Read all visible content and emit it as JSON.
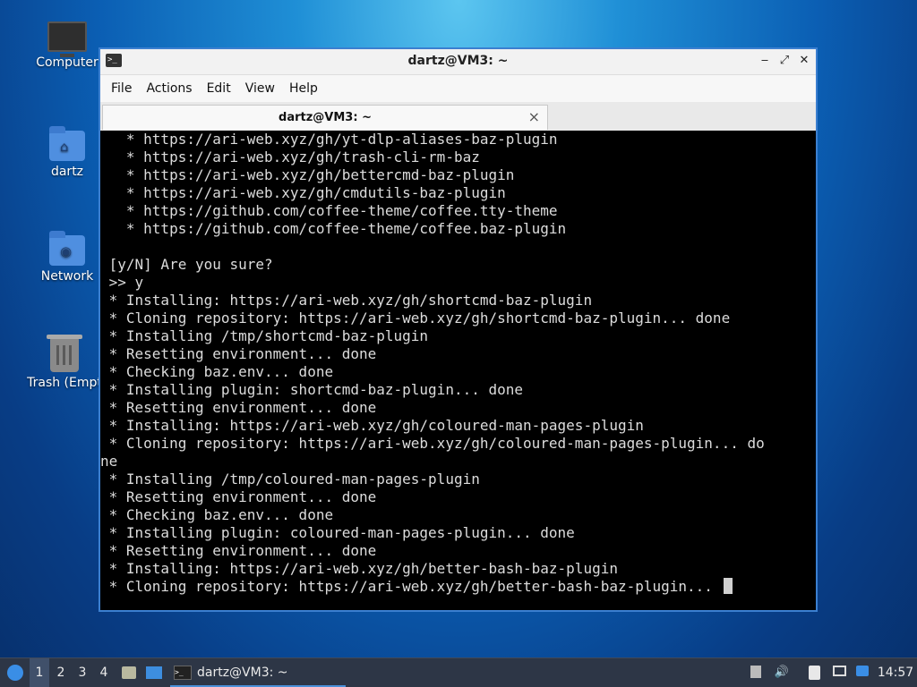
{
  "desktop": {
    "icons": [
      {
        "label": "Computer",
        "icon": "computer-icon"
      },
      {
        "label": "dartz",
        "icon": "home-folder-icon"
      },
      {
        "label": "Network",
        "icon": "network-folder-icon"
      },
      {
        "label": "Trash (Empt",
        "icon": "trash-icon"
      }
    ]
  },
  "window": {
    "title": "dartz@VM3: ~",
    "menu": [
      "File",
      "Actions",
      "Edit",
      "View",
      "Help"
    ],
    "tab_label": "dartz@VM3: ~",
    "tab_close": "×",
    "buttons": {
      "minimize": "‒",
      "maximize": "⤢",
      "close": "✕"
    }
  },
  "terminal": {
    "lines": [
      "   * https://ari-web.xyz/gh/yt-dlp-aliases-baz-plugin",
      "   * https://ari-web.xyz/gh/trash-cli-rm-baz",
      "   * https://ari-web.xyz/gh/bettercmd-baz-plugin",
      "   * https://ari-web.xyz/gh/cmdutils-baz-plugin",
      "   * https://github.com/coffee-theme/coffee.tty-theme",
      "   * https://github.com/coffee-theme/coffee.baz-plugin",
      "",
      " [y/N] Are you sure?",
      " >> y",
      " * Installing: https://ari-web.xyz/gh/shortcmd-baz-plugin",
      " * Cloning repository: https://ari-web.xyz/gh/shortcmd-baz-plugin... done",
      " * Installing /tmp/shortcmd-baz-plugin",
      " * Resetting environment... done",
      " * Checking baz.env... done",
      " * Installing plugin: shortcmd-baz-plugin... done",
      " * Resetting environment... done",
      " * Installing: https://ari-web.xyz/gh/coloured-man-pages-plugin",
      " * Cloning repository: https://ari-web.xyz/gh/coloured-man-pages-plugin... do",
      "ne",
      " * Installing /tmp/coloured-man-pages-plugin",
      " * Resetting environment... done",
      " * Checking baz.env... done",
      " * Installing plugin: coloured-man-pages-plugin... done",
      " * Resetting environment... done",
      " * Installing: https://ari-web.xyz/gh/better-bash-baz-plugin",
      " * Cloning repository: https://ari-web.xyz/gh/better-bash-baz-plugin... "
    ]
  },
  "taskbar": {
    "workspaces": [
      "1",
      "2",
      "3",
      "4"
    ],
    "active_workspace": "1",
    "task_label": "dartz@VM3: ~",
    "clock": "14:57"
  },
  "colors": {
    "accent": "#3b7fd0",
    "terminal_bg": "#000000",
    "terminal_fg": "#dcdcdc",
    "taskbar_bg": "#2d3646"
  }
}
